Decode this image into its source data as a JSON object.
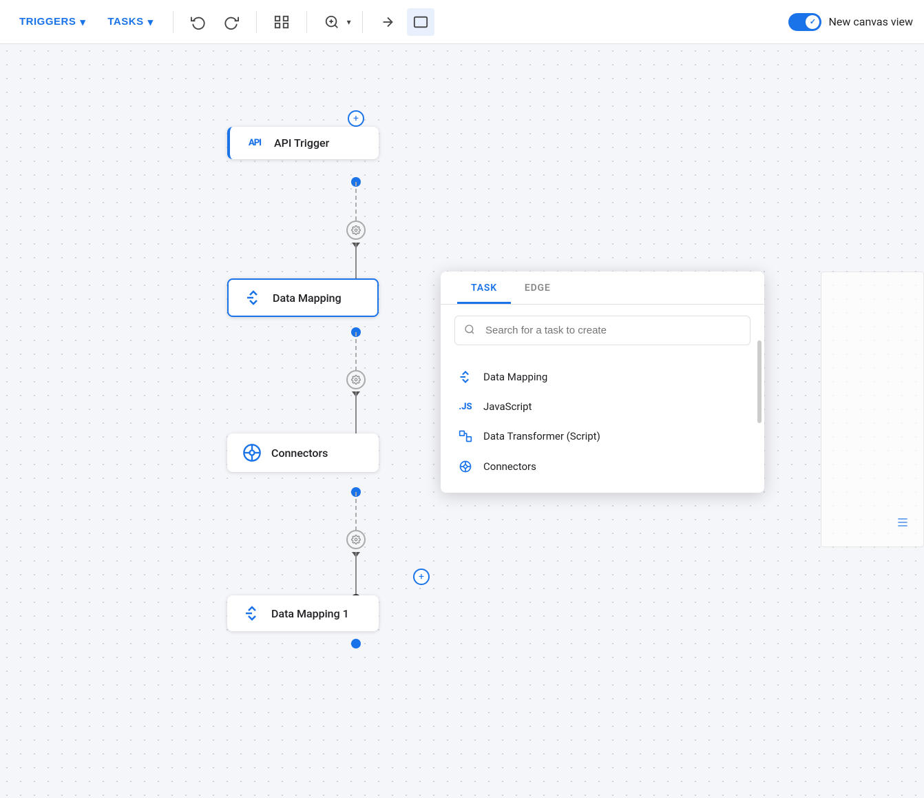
{
  "toolbar": {
    "triggers_label": "TRIGGERS",
    "tasks_label": "TASKS",
    "new_canvas_label": "New canvas view",
    "toggle_on": true
  },
  "nodes": {
    "api_trigger": {
      "label": "API Trigger",
      "icon": "API"
    },
    "data_mapping": {
      "label": "Data Mapping",
      "icon": "↤"
    },
    "connectors": {
      "label": "Connectors",
      "icon": "⊙"
    },
    "data_mapping_1": {
      "label": "Data Mapping 1",
      "icon": "↤"
    }
  },
  "popup": {
    "tab_task": "TASK",
    "tab_edge": "EDGE",
    "search_placeholder": "Search for a task to create",
    "items": [
      {
        "label": "Data Mapping",
        "icon": "data-mapping"
      },
      {
        "label": "JavaScript",
        "icon": "js"
      },
      {
        "label": "Data Transformer (Script)",
        "icon": "data-transformer"
      },
      {
        "label": "Connectors",
        "icon": "connectors"
      }
    ]
  }
}
